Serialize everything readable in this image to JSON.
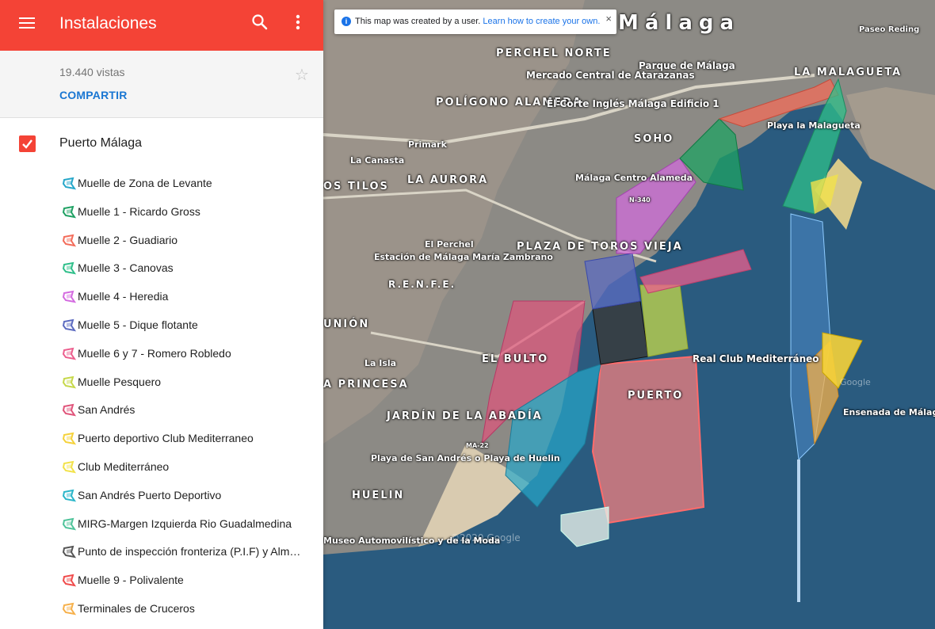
{
  "sidebar": {
    "title": "Instalaciones",
    "views": "19.440 vistas",
    "share_label": "COMPARTIR",
    "layer": {
      "name": "Puerto Málaga",
      "checked": true,
      "items": [
        {
          "label": "Muelle de Zona de Levante",
          "color": "#26a7c9"
        },
        {
          "label": "Muelle 1 - Ricardo Gross",
          "color": "#1fa163"
        },
        {
          "label": "Muelle 2 - Guadiario",
          "color": "#f36c5a"
        },
        {
          "label": "Muelle 3 - Canovas",
          "color": "#2fbf8a"
        },
        {
          "label": "Muelle 4 - Heredia",
          "color": "#d46be0"
        },
        {
          "label": "Muelle 5 - Dique flotante",
          "color": "#5c6bc0"
        },
        {
          "label": "Muelle 6 y 7 - Romero Robledo",
          "color": "#ec5f8e"
        },
        {
          "label": "Muelle Pesquero",
          "color": "#c6d84a"
        },
        {
          "label": "San Andrés",
          "color": "#e0547a"
        },
        {
          "label": "Puerto deportivo Club Mediterraneo",
          "color": "#f5d23a"
        },
        {
          "label": "Club Mediterráneo",
          "color": "#f2e24a"
        },
        {
          "label": "San Andrés Puerto Deportivo",
          "color": "#2bb6c9"
        },
        {
          "label": "MIRG-Margen Izquierda Rio Guadalmedina",
          "color": "#4fc39a"
        },
        {
          "label": "Punto de inspección fronteriza (P.I.F) y Almacenes",
          "color": "#555555"
        },
        {
          "label": "Muelle 9 - Polivalente",
          "color": "#f04b4b"
        },
        {
          "label": "Terminales de Cruceros",
          "color": "#f6b04a"
        }
      ]
    }
  },
  "map": {
    "notice": {
      "text": "This map was created by a user.",
      "link": "Learn how to create your own.",
      "close": "×"
    },
    "labels": [
      {
        "text": "Málaga"
      },
      {
        "text": "PERCHEL NORTE"
      },
      {
        "text": "Mercado Central de Atarazanas"
      },
      {
        "text": "Parque de Málaga"
      },
      {
        "text": "Paseo Reding"
      },
      {
        "text": "LA MALAGUETA"
      },
      {
        "text": "POLÍGONO ALAMEDA"
      },
      {
        "text": "El Corte Inglés Málaga Edificio 1"
      },
      {
        "text": "Playa la Malagueta"
      },
      {
        "text": "SOHO"
      },
      {
        "text": "Primark"
      },
      {
        "text": "La Canasta"
      },
      {
        "text": "LA AURORA"
      },
      {
        "text": "OS TILOS"
      },
      {
        "text": "Málaga Centro Alameda"
      },
      {
        "text": "N-340"
      },
      {
        "text": "El Perchel"
      },
      {
        "text": "Estación de Málaga María Zambrano"
      },
      {
        "text": "R.E.N.F.E."
      },
      {
        "text": "PLAZA DE TOROS VIEJA"
      },
      {
        "text": "UNIÓN"
      },
      {
        "text": "EL BULTO"
      },
      {
        "text": "Real Club Mediterráneo"
      },
      {
        "text": "La Isla"
      },
      {
        "text": "A PRINCESA"
      },
      {
        "text": "PUERTO"
      },
      {
        "text": "JARDÍN DE LA ABADÍA"
      },
      {
        "text": "Ensenada de Málaga"
      },
      {
        "text": "MA-22"
      },
      {
        "text": "Playa de San Andrés o Playa de Huelin"
      },
      {
        "text": "HUELIN"
      },
      {
        "text": "Museo Automovilístico y de la Moda"
      },
      {
        "text": "©2020 Google"
      },
      {
        "text": "Google"
      }
    ]
  }
}
